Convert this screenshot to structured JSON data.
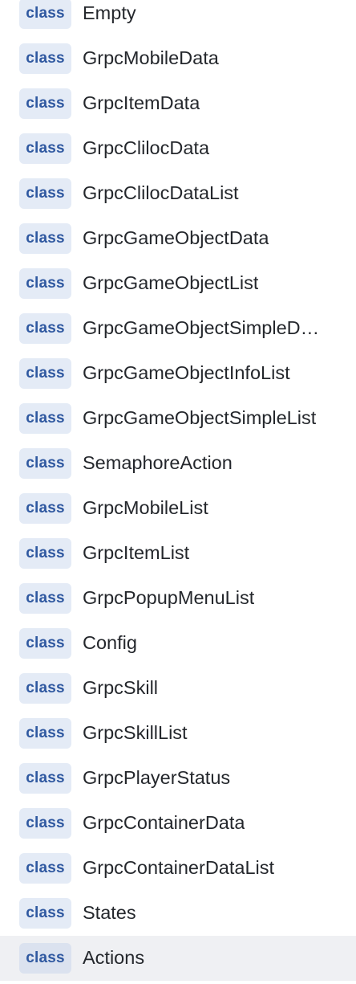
{
  "symbols": [
    {
      "kind": "class",
      "name": "Empty"
    },
    {
      "kind": "class",
      "name": "GrpcMobileData"
    },
    {
      "kind": "class",
      "name": "GrpcItemData"
    },
    {
      "kind": "class",
      "name": "GrpcClilocData"
    },
    {
      "kind": "class",
      "name": "GrpcClilocDataList"
    },
    {
      "kind": "class",
      "name": "GrpcGameObjectData"
    },
    {
      "kind": "class",
      "name": "GrpcGameObjectList"
    },
    {
      "kind": "class",
      "name": "GrpcGameObjectSimpleD…"
    },
    {
      "kind": "class",
      "name": "GrpcGameObjectInfoList"
    },
    {
      "kind": "class",
      "name": "GrpcGameObjectSimpleList"
    },
    {
      "kind": "class",
      "name": "SemaphoreAction"
    },
    {
      "kind": "class",
      "name": "GrpcMobileList"
    },
    {
      "kind": "class",
      "name": "GrpcItemList"
    },
    {
      "kind": "class",
      "name": "GrpcPopupMenuList"
    },
    {
      "kind": "class",
      "name": "Config"
    },
    {
      "kind": "class",
      "name": "GrpcSkill"
    },
    {
      "kind": "class",
      "name": "GrpcSkillList"
    },
    {
      "kind": "class",
      "name": "GrpcPlayerStatus"
    },
    {
      "kind": "class",
      "name": "GrpcContainerData"
    },
    {
      "kind": "class",
      "name": "GrpcContainerDataList"
    },
    {
      "kind": "class",
      "name": "States"
    },
    {
      "kind": "class",
      "name": "Actions",
      "selected": true
    }
  ],
  "colors": {
    "badge_background": "#e4ebf6",
    "badge_text": "#2f58a0",
    "name_text": "#24272c",
    "selected_row_background": "#eff0f3"
  }
}
